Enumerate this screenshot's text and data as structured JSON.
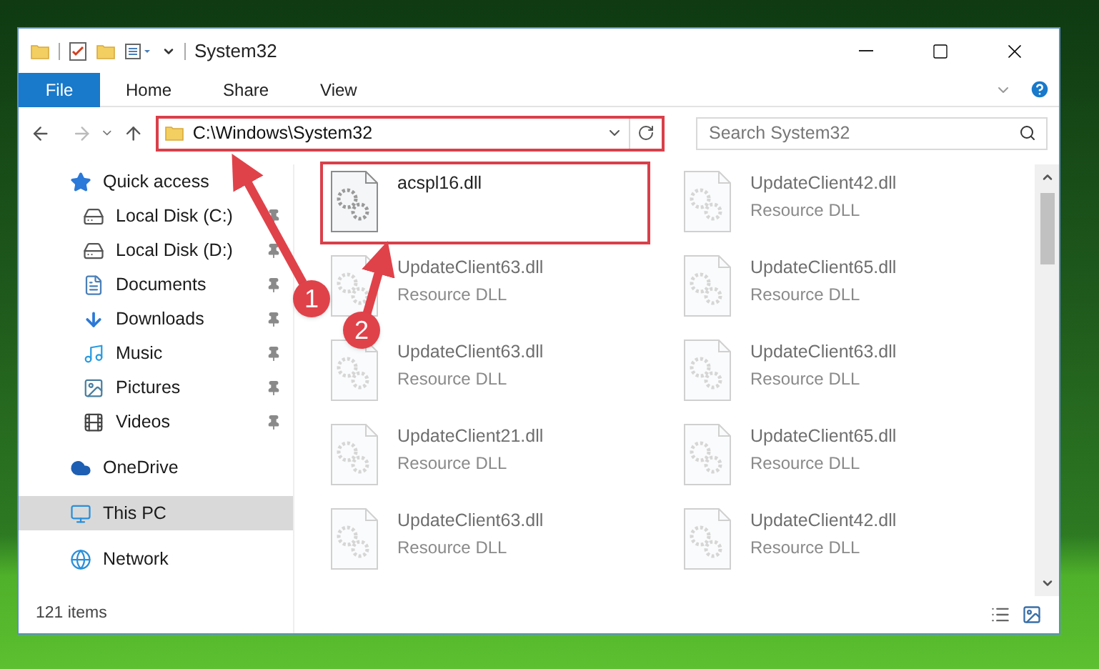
{
  "window": {
    "title": "System32"
  },
  "ribbon": {
    "tabs": [
      {
        "label": "File",
        "kind": "file"
      },
      {
        "label": "Home",
        "kind": "tab"
      },
      {
        "label": "Share",
        "kind": "tab"
      },
      {
        "label": "View",
        "kind": "tab"
      }
    ]
  },
  "address_bar": {
    "path": "C:\\Windows\\System32",
    "highlighted": true
  },
  "search": {
    "placeholder": "Search System32"
  },
  "navigation": [
    {
      "label": "Quick access",
      "kind": "star",
      "selected": false,
      "children": [
        {
          "label": "Local Disk (C:)",
          "kind": "system-drive",
          "pinned": true,
          "selected": false
        },
        {
          "label": "Local Disk (D:)",
          "kind": "drive",
          "pinned": true,
          "selected": false
        },
        {
          "label": "Documents",
          "kind": "documents",
          "pinned": true,
          "selected": false
        },
        {
          "label": "Downloads",
          "kind": "downloads",
          "pinned": true,
          "selected": false
        },
        {
          "label": "Music",
          "kind": "music",
          "pinned": true,
          "selected": false
        },
        {
          "label": "Pictures",
          "kind": "pictures",
          "pinned": true,
          "selected": false
        },
        {
          "label": "Videos",
          "kind": "videos",
          "pinned": true,
          "selected": false
        }
      ]
    },
    {
      "label": "OneDrive",
      "kind": "cloud",
      "selected": false
    },
    {
      "label": "This PC",
      "kind": "pc",
      "selected": true
    },
    {
      "label": "Network",
      "kind": "network",
      "selected": false
    }
  ],
  "files": [
    {
      "name": "acspl16.dll",
      "highlighted": true,
      "blurred": false
    },
    {
      "name": "UpdateClient42.dll",
      "type": "Resource DLL",
      "highlighted": false,
      "blurred": true
    },
    {
      "name": "UpdateClient63.dll",
      "type": "Resource DLL",
      "highlighted": false,
      "blurred": true
    },
    {
      "name": "UpdateClient65.dll",
      "type": "Resource DLL",
      "highlighted": false,
      "blurred": true
    },
    {
      "name": "UpdateClient63.dll",
      "type": "Resource DLL",
      "highlighted": false,
      "blurred": true
    },
    {
      "name": "UpdateClient63.dll",
      "type": "Resource DLL",
      "highlighted": false,
      "blurred": true
    },
    {
      "name": "UpdateClient21.dll",
      "type": "Resource DLL",
      "highlighted": false,
      "blurred": true
    },
    {
      "name": "UpdateClient65.dll",
      "type": "Resource DLL",
      "highlighted": false,
      "blurred": true
    },
    {
      "name": "UpdateClient63.dll",
      "type": "Resource DLL",
      "highlighted": false,
      "blurred": true
    },
    {
      "name": "UpdateClient42.dll",
      "type": "Resource DLL",
      "highlighted": false,
      "blurred": true
    }
  ],
  "status_bar": {
    "item_count": "121 items"
  },
  "annotations": [
    {
      "label": "1"
    },
    {
      "label": "2"
    }
  ]
}
